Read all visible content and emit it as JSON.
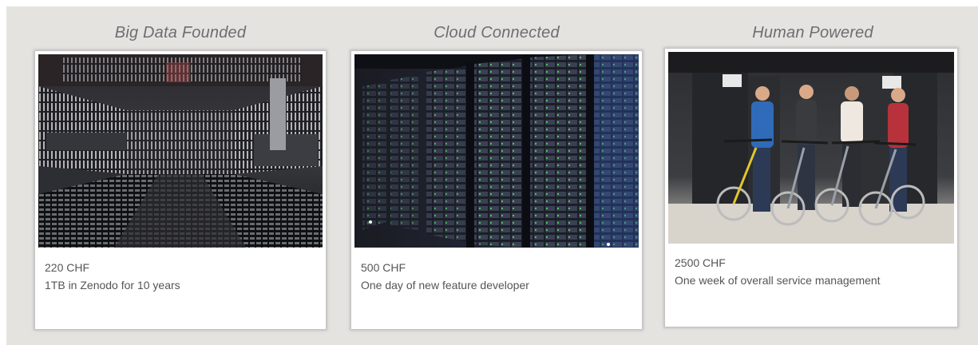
{
  "cards": [
    {
      "title": "Big Data Founded",
      "price": "220 CHF",
      "description": "1TB in Zenodo for 10 years",
      "image_icon": "tape-library-photo"
    },
    {
      "title": "Cloud Connected",
      "price": "500 CHF",
      "description": "One day of new feature developer",
      "image_icon": "server-racks-photo"
    },
    {
      "title": "Human Powered",
      "price": "2500 CHF",
      "description": "One week of overall service management",
      "image_icon": "team-with-bicycles-photo"
    }
  ],
  "colors": {
    "background": "#e4e3e0",
    "title": "#6d6e70",
    "text": "#555555"
  }
}
